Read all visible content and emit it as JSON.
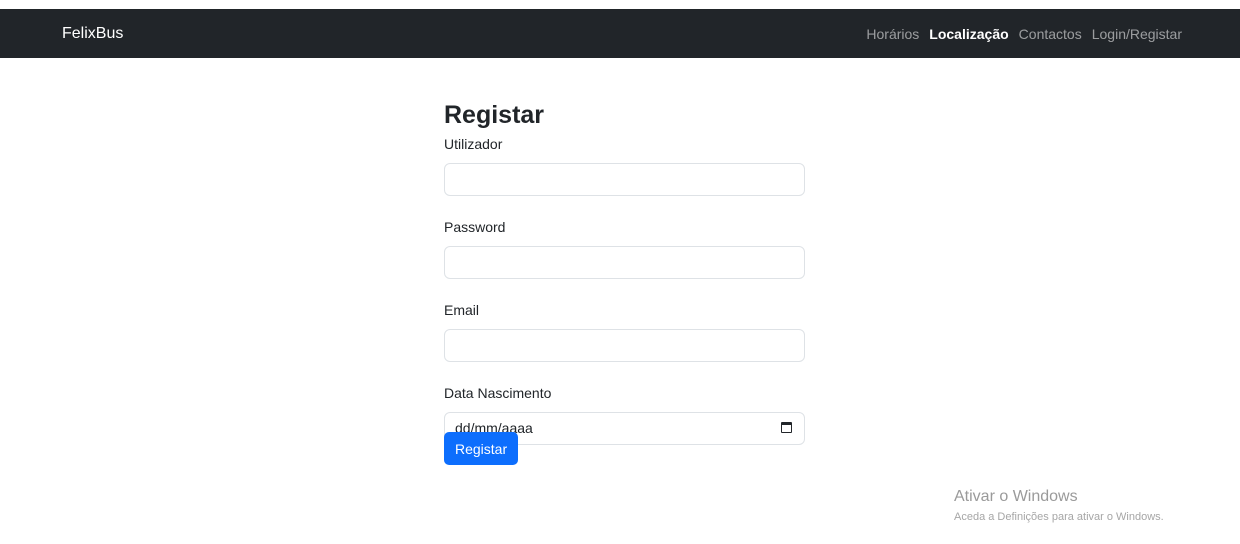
{
  "nav": {
    "brand": "FelixBus",
    "links": [
      "Horários",
      "Localização",
      "Contactos",
      "Login/Registar"
    ]
  },
  "form": {
    "title": "Registar",
    "fields": {
      "username_label": "Utilizador",
      "password_label": "Password",
      "email_label": "Email",
      "birthdate_label": "Data Nascimento",
      "birthdate_placeholder": "dd/mm/aaaa"
    },
    "submit_label": "Registar"
  },
  "watermark": {
    "title": "Ativar o Windows",
    "subtitle": "Aceda a Definições para ativar o Windows."
  },
  "colors": {
    "navbar_bg": "#212529",
    "primary": "#0d6efd"
  },
  "icons": {
    "date_picker": "calendar-icon"
  }
}
